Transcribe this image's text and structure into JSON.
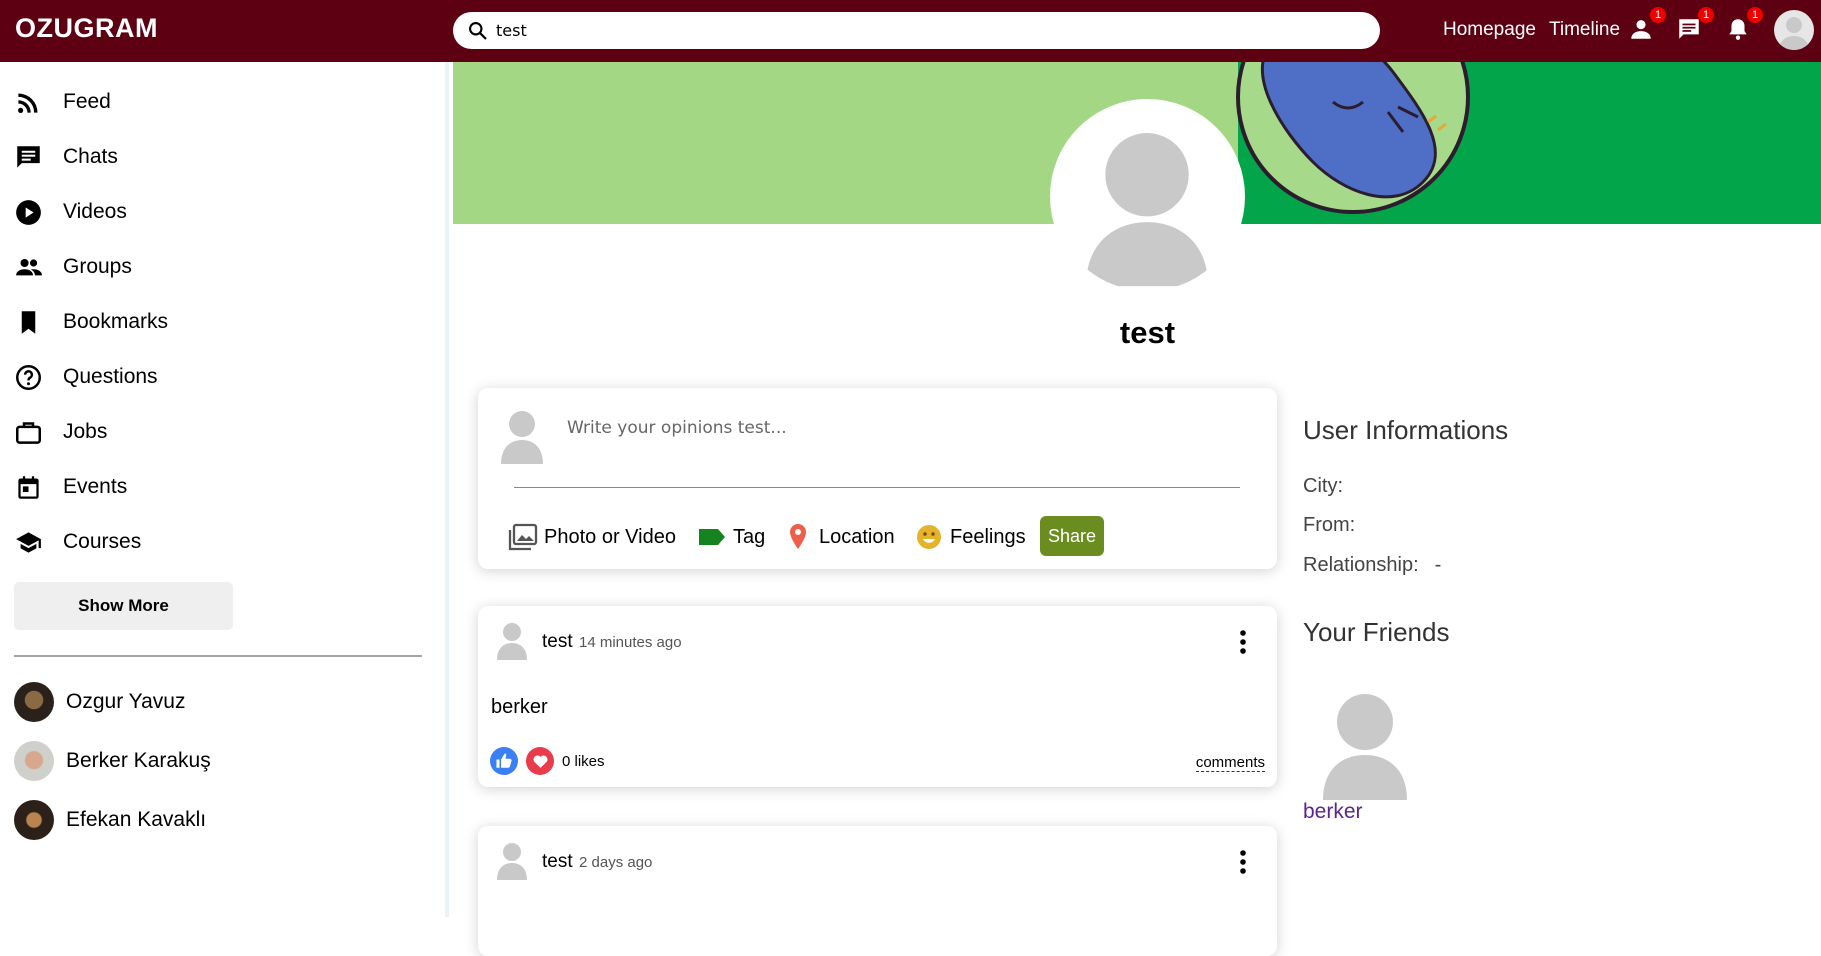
{
  "app": {
    "logo": "OZUGRAM"
  },
  "search": {
    "value": "test"
  },
  "toplinks": {
    "homepage": "Homepage",
    "timeline": "Timeline"
  },
  "badges": {
    "friends": "1",
    "messages": "1",
    "notifications": "1"
  },
  "sidebar": {
    "items": [
      {
        "label": "Feed",
        "icon": "rss-icon"
      },
      {
        "label": "Chats",
        "icon": "chat-icon"
      },
      {
        "label": "Videos",
        "icon": "play-icon"
      },
      {
        "label": "Groups",
        "icon": "group-icon"
      },
      {
        "label": "Bookmarks",
        "icon": "bookmark-icon"
      },
      {
        "label": "Questions",
        "icon": "question-icon"
      },
      {
        "label": "Jobs",
        "icon": "briefcase-icon"
      },
      {
        "label": "Events",
        "icon": "calendar-icon"
      },
      {
        "label": "Courses",
        "icon": "school-icon"
      }
    ],
    "show_more": "Show More",
    "friends": [
      {
        "name": "Ozgur Yavuz"
      },
      {
        "name": "Berker Karakuş"
      },
      {
        "name": "Efekan Kavaklı"
      }
    ]
  },
  "profile": {
    "name": "test"
  },
  "composer": {
    "placeholder": "Write your opinions test...",
    "options": {
      "photo": "Photo or Video",
      "tag": "Tag",
      "location": "Location",
      "feelings": "Feelings"
    },
    "share": "Share"
  },
  "posts": [
    {
      "user": "test",
      "time": "14 minutes ago",
      "body": "berker",
      "likes": "0 likes",
      "comments": "comments"
    },
    {
      "user": "test",
      "time": "2 days ago",
      "body": ""
    }
  ],
  "info": {
    "title": "User Informations",
    "city_label": "City:",
    "city": "",
    "from_label": "From:",
    "from": "",
    "relationship_label": "Relationship:",
    "relationship": "-"
  },
  "friends_panel": {
    "title": "Your Friends",
    "friends": [
      {
        "name": "berker"
      }
    ]
  },
  "colors": {
    "topbar": "#5d0012",
    "share": "#6b8d1f",
    "friend_link": "#5a2590"
  }
}
